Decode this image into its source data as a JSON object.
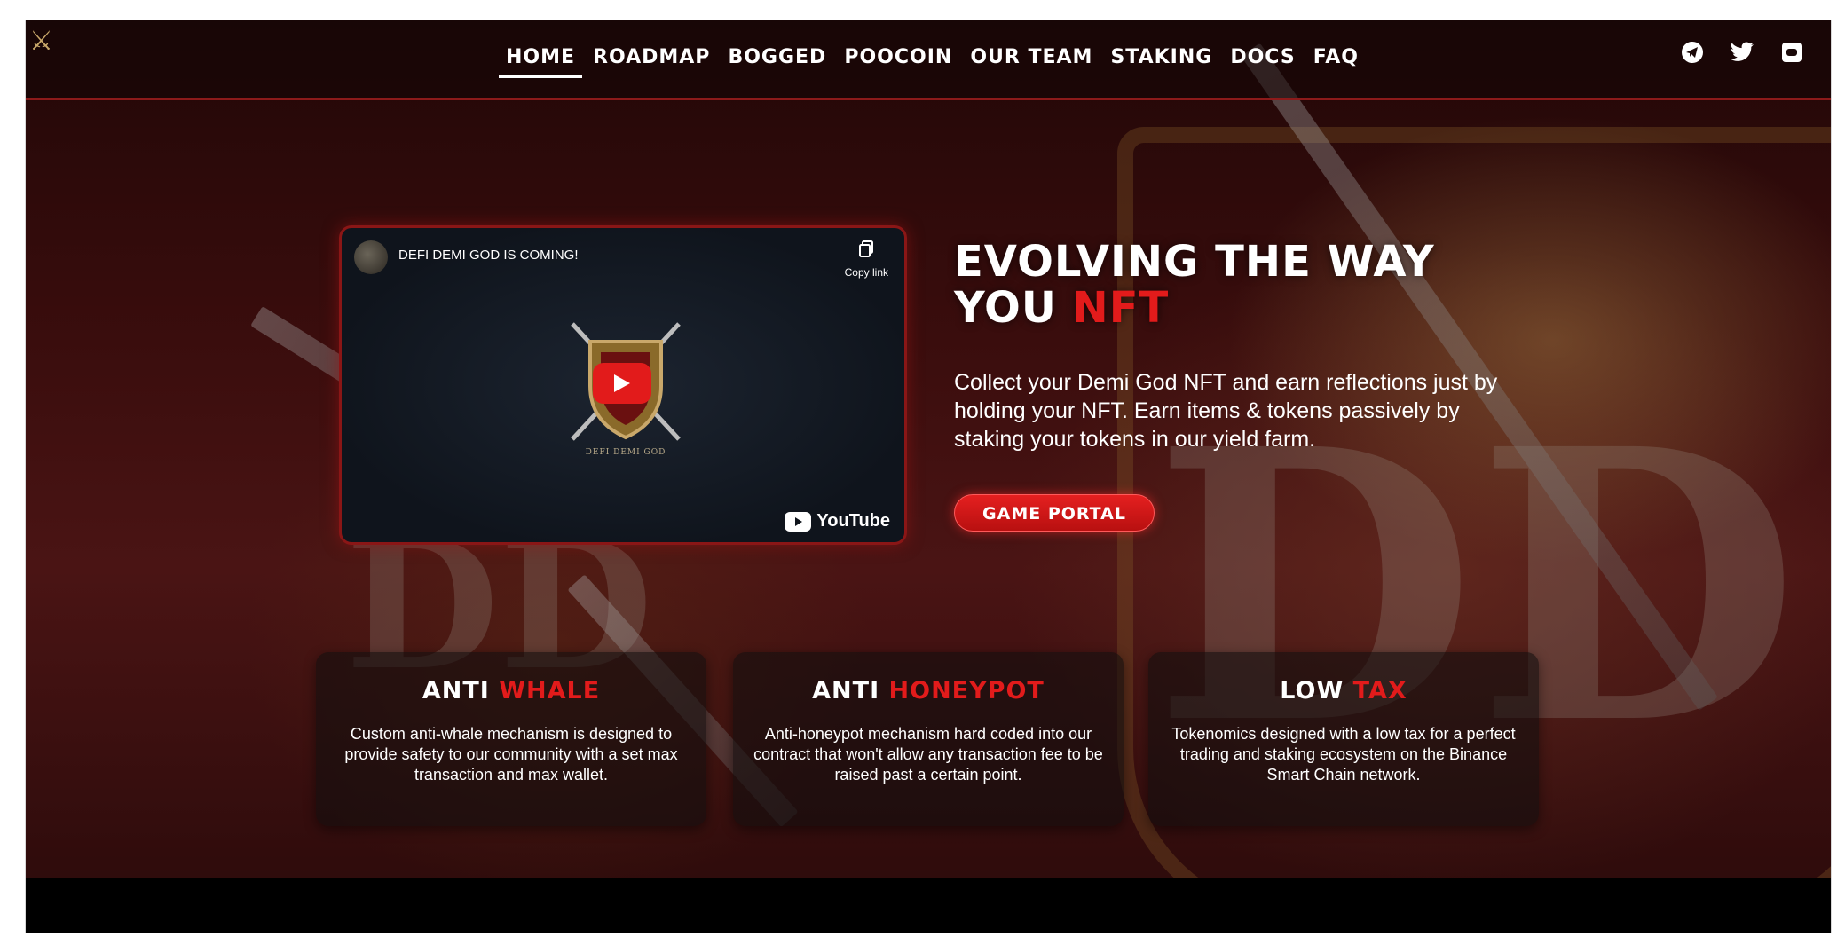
{
  "nav": {
    "links": [
      "HOME",
      "ROADMAP",
      "BOGGED",
      "POOCOIN",
      "OUR TEAM",
      "STAKING",
      "DOCS",
      "FAQ"
    ],
    "active": "HOME",
    "socials": [
      "telegram-icon",
      "twitter-icon",
      "discord-icon"
    ]
  },
  "video": {
    "title": "DEFI DEMI GOD IS COMING!",
    "copy_label": "Copy link",
    "emblem_text": "DEFI DEMI GOD",
    "platform_label": "YouTube"
  },
  "hero": {
    "title_line1": "EVOLVING THE WAY",
    "title_line2_prefix": "YOU",
    "title_line2_accent": "NFT",
    "description": "Collect your Demi God NFT and earn reflections just by holding your NFT. Earn items & tokens passively by staking your tokens in our yield farm.",
    "button_label": "GAME PORTAL"
  },
  "features": [
    {
      "title_prefix": "ANTI",
      "title_accent": "WHALE",
      "description": "Custom anti-whale mechanism is designed to provide safety to our community with a set max transaction and max wallet."
    },
    {
      "title_prefix": "ANTI",
      "title_accent": "HONEYPOT",
      "description": "Anti-honeypot mechanism hard coded into our contract that won't allow any transaction fee to be raised past a certain point."
    },
    {
      "title_prefix": "LOW",
      "title_accent": "TAX",
      "description": "Tokenomics designed with a low tax for a perfect trading and staking ecosystem on the Binance Smart Chain network."
    }
  ],
  "colors": {
    "accent": "#e21b1b",
    "nav_border": "#8d1a1a",
    "background": "#1a0808"
  }
}
